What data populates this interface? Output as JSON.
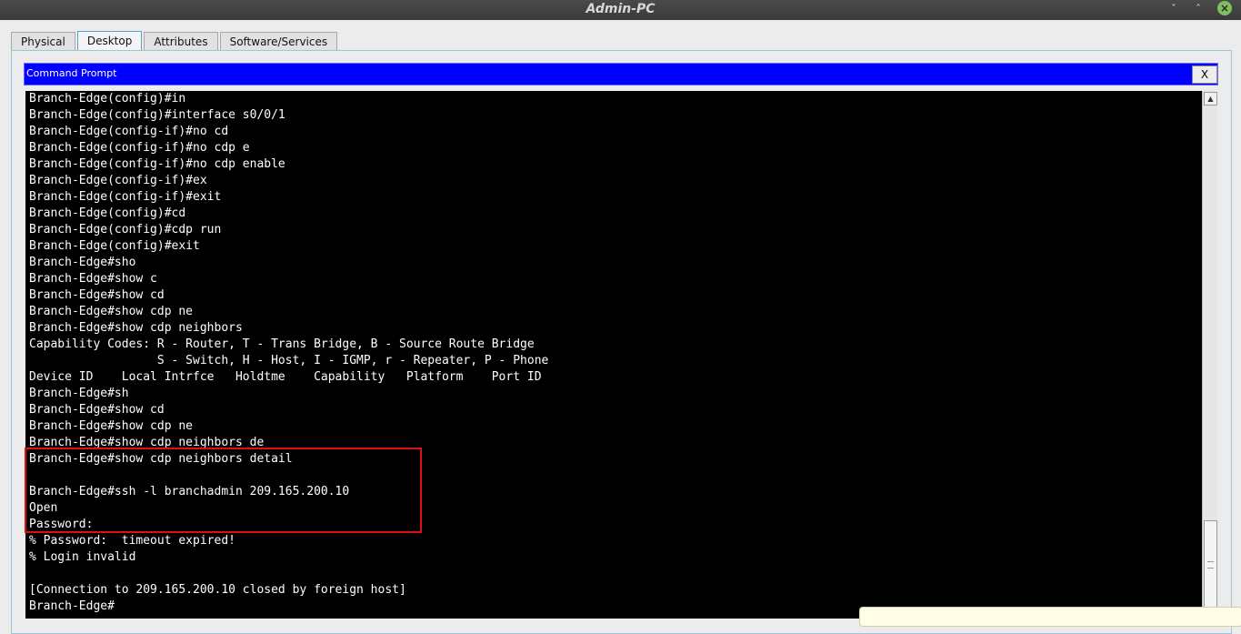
{
  "window": {
    "title": "Admin-PC",
    "min_glyph": "ˇ",
    "max_glyph": "ˆ",
    "close_glyph": "×"
  },
  "tabs": [
    {
      "label": "Physical",
      "active": false
    },
    {
      "label": "Desktop",
      "active": true
    },
    {
      "label": "Attributes",
      "active": false
    },
    {
      "label": "Software/Services",
      "active": false
    }
  ],
  "command_prompt": {
    "title": "Command Prompt",
    "close_label": "X"
  },
  "terminal": {
    "lines": [
      "Branch-Edge(config)#in",
      "Branch-Edge(config)#interface s0/0/1",
      "Branch-Edge(config-if)#no cd",
      "Branch-Edge(config-if)#no cdp e",
      "Branch-Edge(config-if)#no cdp enable",
      "Branch-Edge(config-if)#ex",
      "Branch-Edge(config-if)#exit",
      "Branch-Edge(config)#cd",
      "Branch-Edge(config)#cdp run",
      "Branch-Edge(config)#exit",
      "Branch-Edge#sho",
      "Branch-Edge#show c",
      "Branch-Edge#show cd",
      "Branch-Edge#show cdp ne",
      "Branch-Edge#show cdp neighbors",
      "Capability Codes: R - Router, T - Trans Bridge, B - Source Route Bridge",
      "                  S - Switch, H - Host, I - IGMP, r - Repeater, P - Phone",
      "Device ID    Local Intrfce   Holdtme    Capability   Platform    Port ID",
      "Branch-Edge#sh",
      "Branch-Edge#show cd",
      "Branch-Edge#show cdp ne",
      "Branch-Edge#show cdp neighbors de",
      "Branch-Edge#show cdp neighbors detail",
      "",
      "Branch-Edge#ssh -l branchadmin 209.165.200.10",
      "Open",
      "Password:",
      "% Password:  timeout expired!",
      "% Login invalid",
      "",
      "[Connection to 209.165.200.10 closed by foreign host]",
      "Branch-Edge#"
    ],
    "highlight_color": "#e01010"
  },
  "scrollbar": {
    "up_glyph": "▲"
  },
  "colors": {
    "header_blue": "#0000ff",
    "terminal_bg": "#000000",
    "terminal_fg": "#ffffff"
  }
}
